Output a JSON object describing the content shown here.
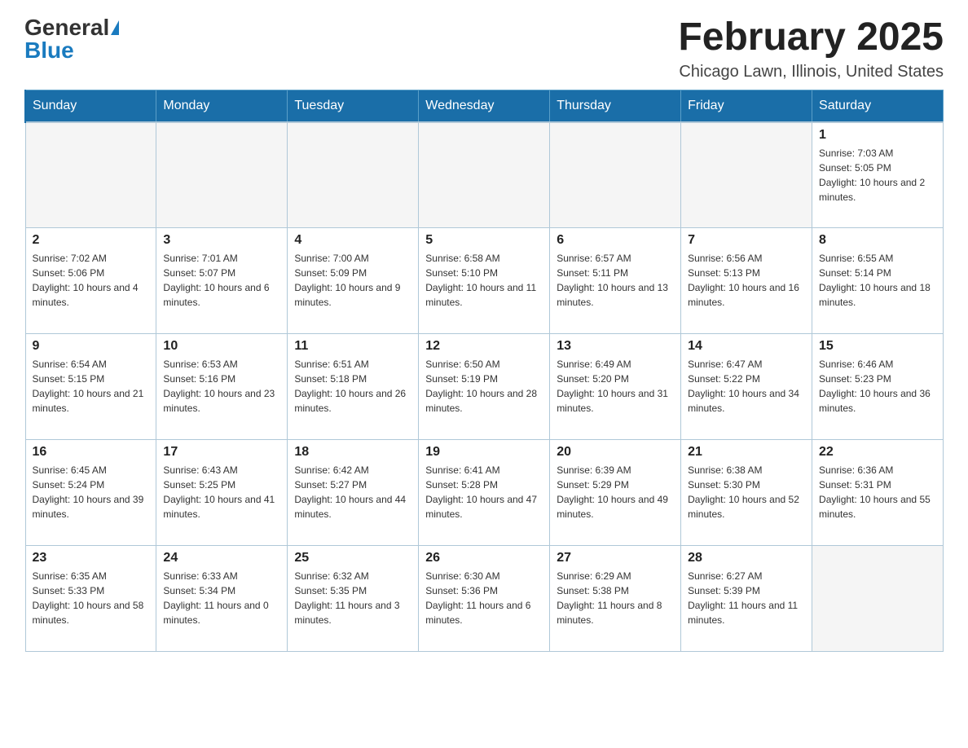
{
  "header": {
    "logo_general": "General",
    "logo_blue": "Blue",
    "title": "February 2025",
    "subtitle": "Chicago Lawn, Illinois, United States"
  },
  "weekdays": [
    "Sunday",
    "Monday",
    "Tuesday",
    "Wednesday",
    "Thursday",
    "Friday",
    "Saturday"
  ],
  "weeks": [
    [
      {
        "day": "",
        "info": ""
      },
      {
        "day": "",
        "info": ""
      },
      {
        "day": "",
        "info": ""
      },
      {
        "day": "",
        "info": ""
      },
      {
        "day": "",
        "info": ""
      },
      {
        "day": "",
        "info": ""
      },
      {
        "day": "1",
        "info": "Sunrise: 7:03 AM\nSunset: 5:05 PM\nDaylight: 10 hours and 2 minutes."
      }
    ],
    [
      {
        "day": "2",
        "info": "Sunrise: 7:02 AM\nSunset: 5:06 PM\nDaylight: 10 hours and 4 minutes."
      },
      {
        "day": "3",
        "info": "Sunrise: 7:01 AM\nSunset: 5:07 PM\nDaylight: 10 hours and 6 minutes."
      },
      {
        "day": "4",
        "info": "Sunrise: 7:00 AM\nSunset: 5:09 PM\nDaylight: 10 hours and 9 minutes."
      },
      {
        "day": "5",
        "info": "Sunrise: 6:58 AM\nSunset: 5:10 PM\nDaylight: 10 hours and 11 minutes."
      },
      {
        "day": "6",
        "info": "Sunrise: 6:57 AM\nSunset: 5:11 PM\nDaylight: 10 hours and 13 minutes."
      },
      {
        "day": "7",
        "info": "Sunrise: 6:56 AM\nSunset: 5:13 PM\nDaylight: 10 hours and 16 minutes."
      },
      {
        "day": "8",
        "info": "Sunrise: 6:55 AM\nSunset: 5:14 PM\nDaylight: 10 hours and 18 minutes."
      }
    ],
    [
      {
        "day": "9",
        "info": "Sunrise: 6:54 AM\nSunset: 5:15 PM\nDaylight: 10 hours and 21 minutes."
      },
      {
        "day": "10",
        "info": "Sunrise: 6:53 AM\nSunset: 5:16 PM\nDaylight: 10 hours and 23 minutes."
      },
      {
        "day": "11",
        "info": "Sunrise: 6:51 AM\nSunset: 5:18 PM\nDaylight: 10 hours and 26 minutes."
      },
      {
        "day": "12",
        "info": "Sunrise: 6:50 AM\nSunset: 5:19 PM\nDaylight: 10 hours and 28 minutes."
      },
      {
        "day": "13",
        "info": "Sunrise: 6:49 AM\nSunset: 5:20 PM\nDaylight: 10 hours and 31 minutes."
      },
      {
        "day": "14",
        "info": "Sunrise: 6:47 AM\nSunset: 5:22 PM\nDaylight: 10 hours and 34 minutes."
      },
      {
        "day": "15",
        "info": "Sunrise: 6:46 AM\nSunset: 5:23 PM\nDaylight: 10 hours and 36 minutes."
      }
    ],
    [
      {
        "day": "16",
        "info": "Sunrise: 6:45 AM\nSunset: 5:24 PM\nDaylight: 10 hours and 39 minutes."
      },
      {
        "day": "17",
        "info": "Sunrise: 6:43 AM\nSunset: 5:25 PM\nDaylight: 10 hours and 41 minutes."
      },
      {
        "day": "18",
        "info": "Sunrise: 6:42 AM\nSunset: 5:27 PM\nDaylight: 10 hours and 44 minutes."
      },
      {
        "day": "19",
        "info": "Sunrise: 6:41 AM\nSunset: 5:28 PM\nDaylight: 10 hours and 47 minutes."
      },
      {
        "day": "20",
        "info": "Sunrise: 6:39 AM\nSunset: 5:29 PM\nDaylight: 10 hours and 49 minutes."
      },
      {
        "day": "21",
        "info": "Sunrise: 6:38 AM\nSunset: 5:30 PM\nDaylight: 10 hours and 52 minutes."
      },
      {
        "day": "22",
        "info": "Sunrise: 6:36 AM\nSunset: 5:31 PM\nDaylight: 10 hours and 55 minutes."
      }
    ],
    [
      {
        "day": "23",
        "info": "Sunrise: 6:35 AM\nSunset: 5:33 PM\nDaylight: 10 hours and 58 minutes."
      },
      {
        "day": "24",
        "info": "Sunrise: 6:33 AM\nSunset: 5:34 PM\nDaylight: 11 hours and 0 minutes."
      },
      {
        "day": "25",
        "info": "Sunrise: 6:32 AM\nSunset: 5:35 PM\nDaylight: 11 hours and 3 minutes."
      },
      {
        "day": "26",
        "info": "Sunrise: 6:30 AM\nSunset: 5:36 PM\nDaylight: 11 hours and 6 minutes."
      },
      {
        "day": "27",
        "info": "Sunrise: 6:29 AM\nSunset: 5:38 PM\nDaylight: 11 hours and 8 minutes."
      },
      {
        "day": "28",
        "info": "Sunrise: 6:27 AM\nSunset: 5:39 PM\nDaylight: 11 hours and 11 minutes."
      },
      {
        "day": "",
        "info": ""
      }
    ]
  ]
}
